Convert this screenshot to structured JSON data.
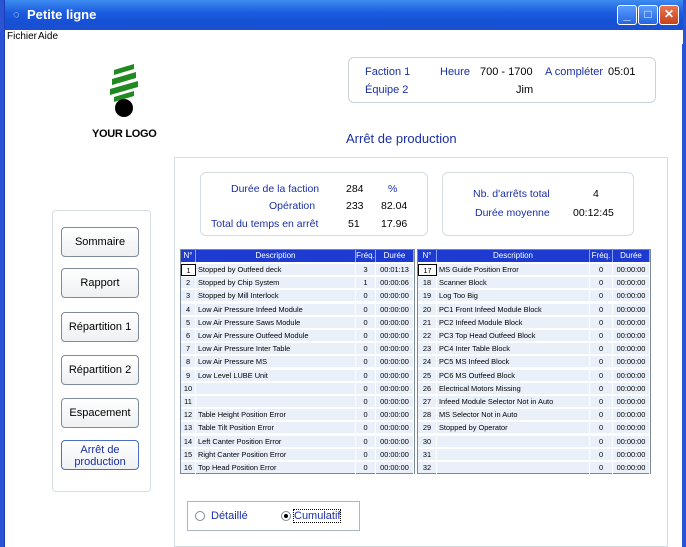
{
  "window": {
    "title": "Petite ligne",
    "controls": {
      "minimize": "_",
      "maximize": "□",
      "close": "✕"
    }
  },
  "menu": {
    "items": [
      "Fichier",
      "Aide"
    ]
  },
  "logo": {
    "text": "YOUR LOGO",
    "colors": {
      "tree": "#1f8a1f",
      "ball": "#000000"
    }
  },
  "info": {
    "faction_label": "Faction 1",
    "equipe_label": "Équipe 2",
    "heure_label": "Heure",
    "heure_value": "700 - 1700",
    "operator": "Jim",
    "a_completer_label": "A compléter",
    "a_completer_value": "05:01"
  },
  "section_title": "Arrêt de production",
  "nav": {
    "sommaire": "Sommaire",
    "rapport": "Rapport",
    "repartition1": "Répartition 1",
    "repartition2": "Répartition 2",
    "espacement": "Espacement",
    "arret_line1": "Arrêt de",
    "arret_line2": "production"
  },
  "stats": {
    "duree_faction_label": "Durée de la faction",
    "duree_faction_value": "284",
    "percent_header": "%",
    "operation_label": "Opération",
    "operation_value": "233",
    "operation_pct": "82.04",
    "total_arret_label": "Total du temps en arrêt",
    "total_arret_value": "51",
    "total_arret_pct": "17.96",
    "nb_arrets_label": "Nb. d'arrêts total",
    "nb_arrets_value": "4",
    "duree_moyenne_label": "Durée moyenne",
    "duree_moyenne_value": "00:12:45"
  },
  "grid": {
    "headers": {
      "num": "N°",
      "description": "Description",
      "freq": "Fréq.",
      "duree": "Durée"
    },
    "left_rows": [
      {
        "num": "1",
        "description": "Stopped by Outfeed deck",
        "freq": "3",
        "duree": "00:01:13"
      },
      {
        "num": "2",
        "description": "Stopped by Chip System",
        "freq": "1",
        "duree": "00:00:06"
      },
      {
        "num": "3",
        "description": "Stopped by Mill Interlock",
        "freq": "0",
        "duree": "00:00:00"
      },
      {
        "num": "4",
        "description": "Low Air Pressure Infeed Module",
        "freq": "0",
        "duree": "00:00:00"
      },
      {
        "num": "5",
        "description": "Low Air Pressure Saws Module",
        "freq": "0",
        "duree": "00:00:00"
      },
      {
        "num": "6",
        "description": "Low Air Pressure Outfeed Module",
        "freq": "0",
        "duree": "00:00:00"
      },
      {
        "num": "7",
        "description": "Low Air Pressure Inter Table",
        "freq": "0",
        "duree": "00:00:00"
      },
      {
        "num": "8",
        "description": "Low Air Pressure MS",
        "freq": "0",
        "duree": "00:00:00"
      },
      {
        "num": "9",
        "description": "Low Level LUBE Unit",
        "freq": "0",
        "duree": "00:00:00"
      },
      {
        "num": "10",
        "description": "",
        "freq": "0",
        "duree": "00:00:00"
      },
      {
        "num": "11",
        "description": "",
        "freq": "0",
        "duree": "00:00:00"
      },
      {
        "num": "12",
        "description": "Table Height Position Error",
        "freq": "0",
        "duree": "00:00:00"
      },
      {
        "num": "13",
        "description": "Table Tilt Position Error",
        "freq": "0",
        "duree": "00:00:00"
      },
      {
        "num": "14",
        "description": "Left Canter Position Error",
        "freq": "0",
        "duree": "00:00:00"
      },
      {
        "num": "15",
        "description": "Right Canter Position Error",
        "freq": "0",
        "duree": "00:00:00"
      },
      {
        "num": "16",
        "description": "Top Head Position Error",
        "freq": "0",
        "duree": "00:00:00"
      }
    ],
    "right_rows": [
      {
        "num": "17",
        "description": "MS Guide Position Error",
        "freq": "0",
        "duree": "00:00:00"
      },
      {
        "num": "18",
        "description": "Scanner Block",
        "freq": "0",
        "duree": "00:00:00"
      },
      {
        "num": "19",
        "description": "Log Too Big",
        "freq": "0",
        "duree": "00:00:00"
      },
      {
        "num": "20",
        "description": "PC1 Front Infeed  Module Block",
        "freq": "0",
        "duree": "00:00:00"
      },
      {
        "num": "21",
        "description": "PC2 Infeed Module Block",
        "freq": "0",
        "duree": "00:00:00"
      },
      {
        "num": "22",
        "description": "PC3 Top Head Outfeed Block",
        "freq": "0",
        "duree": "00:00:00"
      },
      {
        "num": "23",
        "description": "PC4 Inter Table Block",
        "freq": "0",
        "duree": "00:00:00"
      },
      {
        "num": "24",
        "description": "PC5 MS Infeed Block",
        "freq": "0",
        "duree": "00:00:00"
      },
      {
        "num": "25",
        "description": "PC6 MS Outfeed Block",
        "freq": "0",
        "duree": "00:00:00"
      },
      {
        "num": "26",
        "description": "Electrical Motors Missing",
        "freq": "0",
        "duree": "00:00:00"
      },
      {
        "num": "27",
        "description": "Infeed Module Selector Not in Auto",
        "freq": "0",
        "duree": "00:00:00"
      },
      {
        "num": "28",
        "description": "MS Selector Not in Auto",
        "freq": "0",
        "duree": "00:00:00"
      },
      {
        "num": "29",
        "description": "Stopped by Operator",
        "freq": "0",
        "duree": "00:00:00"
      },
      {
        "num": "30",
        "description": "",
        "freq": "0",
        "duree": "00:00:00"
      },
      {
        "num": "31",
        "description": "",
        "freq": "0",
        "duree": "00:00:00"
      },
      {
        "num": "32",
        "description": "",
        "freq": "0",
        "duree": "00:00:00"
      }
    ]
  },
  "view_mode": {
    "detaille_label": "Détaillé",
    "cumulatif_label": "Cumulatif",
    "selected": "Cumulatif"
  },
  "colors": {
    "accent": "#1a2fa6",
    "grid_header": "#1d3bd1",
    "row_bg": "#eaf0fa",
    "titlebar": "#1c5ee0"
  }
}
